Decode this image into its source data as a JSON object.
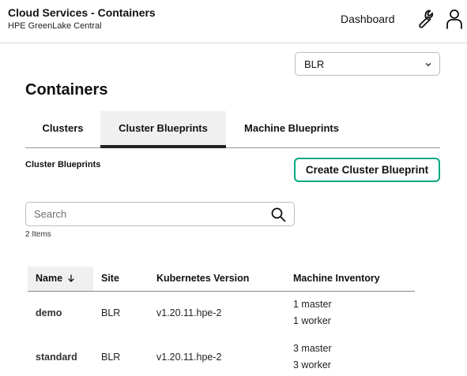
{
  "header": {
    "title": "Cloud Services - Containers",
    "subtitle": "HPE GreenLake Central",
    "dashboard_label": "Dashboard"
  },
  "site_select": {
    "value": "BLR"
  },
  "page_title": "Containers",
  "tabs": [
    {
      "label": "Clusters",
      "active": false
    },
    {
      "label": "Cluster Blueprints",
      "active": true
    },
    {
      "label": "Machine Blueprints",
      "active": false
    }
  ],
  "section": {
    "title": "Cluster Blueprints",
    "create_button": "Create Cluster Blueprint"
  },
  "search": {
    "placeholder": "Search"
  },
  "item_count": "2 Items",
  "table": {
    "columns": [
      "Name",
      "Site",
      "Kubernetes Version",
      "Machine Inventory"
    ],
    "rows": [
      {
        "name": "demo",
        "site": "BLR",
        "kubernetes_version": "v1.20.11.hpe-2",
        "inventory": [
          "1 master",
          "1 worker"
        ]
      },
      {
        "name": "standard",
        "site": "BLR",
        "kubernetes_version": "v1.20.11.hpe-2",
        "inventory": [
          "3 master",
          "3 worker"
        ]
      }
    ]
  },
  "colors": {
    "accent": "#01a982",
    "tab_active_bg": "#f0f0f0",
    "border": "#bdbdbd"
  },
  "icons": [
    "wrench-icon",
    "user-icon",
    "chevron-down-icon",
    "search-icon",
    "sort-arrow-down-icon"
  ]
}
